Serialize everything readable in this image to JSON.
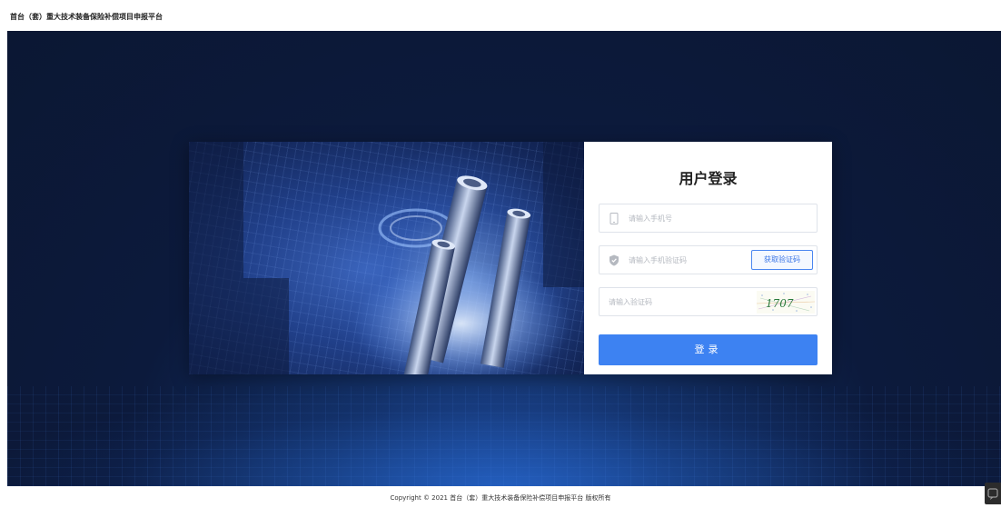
{
  "header": {
    "site_title": "首台（套）重大技术装备保险补偿项目申报平台"
  },
  "login": {
    "title": "用户登录",
    "phone_placeholder": "请输入手机号",
    "sms_code_placeholder": "请输入手机验证码",
    "get_sms_code_label": "获取验证码",
    "captcha_placeholder": "请输入验证码",
    "captcha_text": "1707",
    "submit_label": "登录"
  },
  "footer": {
    "copyright": "Copyright © 2021 首台（套）重大技术装备保险补偿项目申报平台 版权所有"
  },
  "colors": {
    "accent": "#3d82f2",
    "hero_background": "#0c1a3c"
  },
  "icons": {
    "phone_field": "mobile-phone-icon",
    "sms_field": "shield-icon",
    "corner": "chat-widget-icon"
  }
}
